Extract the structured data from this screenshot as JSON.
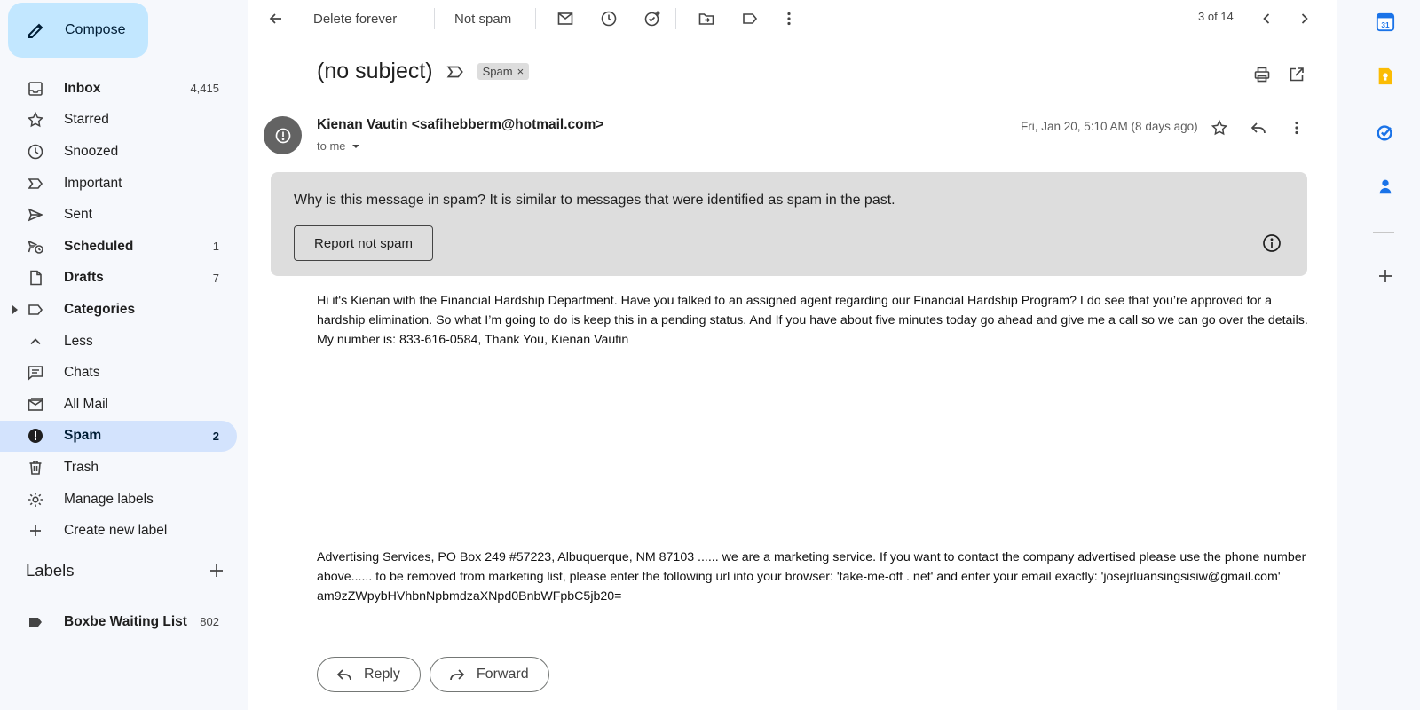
{
  "sidebar": {
    "compose_label": "Compose",
    "items": [
      {
        "label": "Inbox",
        "count": "4,415"
      },
      {
        "label": "Starred",
        "count": ""
      },
      {
        "label": "Snoozed",
        "count": ""
      },
      {
        "label": "Important",
        "count": ""
      },
      {
        "label": "Sent",
        "count": ""
      },
      {
        "label": "Scheduled",
        "count": "1"
      },
      {
        "label": "Drafts",
        "count": "7"
      },
      {
        "label": "Categories",
        "count": ""
      },
      {
        "label": "Less",
        "count": ""
      },
      {
        "label": "Chats",
        "count": ""
      },
      {
        "label": "All Mail",
        "count": ""
      },
      {
        "label": "Spam",
        "count": "2"
      },
      {
        "label": "Trash",
        "count": ""
      },
      {
        "label": "Manage labels",
        "count": ""
      },
      {
        "label": "Create new label",
        "count": ""
      }
    ],
    "labels_heading": "Labels",
    "custom_labels": [
      {
        "label": "Boxbe Waiting List",
        "count": "802"
      }
    ]
  },
  "toolbar": {
    "delete_forever": "Delete forever",
    "not_spam": "Not spam",
    "pager": "3 of 14"
  },
  "email": {
    "subject": "(no subject)",
    "chip": "Spam",
    "chip_close": "×",
    "sender": "Kienan Vautin <safihebberm@hotmail.com>",
    "to": "to me",
    "date": "Fri, Jan 20, 5:10 AM (8 days ago)",
    "spam_why_bold": "Why is this message in spam?",
    "spam_why_rest": " It is similar to messages that were identified as spam in the past.",
    "report_not_spam": "Report not spam",
    "body1": "Hi it's Kienan with the Financial Hardship Department. Have you talked to an assigned agent regarding our Financial Hardship Program? I do see that you’re approved for a hardship elimination. So what I’m going to do is keep this in a pending status. And If you have about five minutes today go ahead and give me a call so we can go over the details. My number is: 833-616-0584, Thank You, Kienan Vautin",
    "body2": "Advertising Services, PO Box 249 #57223, Albuquerque, NM 87103 ...... we are a marketing service. If you want to contact the company advertised please use the phone number above...... to be removed from marketing list, please enter the following url into your browser: 'take-me-off . net' and enter your email exactly: 'josejrluansingsisiw@gmail.com' am9zZWpybHVhbnNpbmdzaXNpd0BnbWFpbC5jb20=",
    "reply_label": "Reply",
    "forward_label": "Forward"
  },
  "rightbar": {
    "calendar_day": "31"
  },
  "colors": {
    "compose_bg": "#c2e7ff",
    "active_nav_bg": "#d3e3fd",
    "spam_box_bg": "#dddddd",
    "calendar": "#1a73e8",
    "keep": "#fbbc04",
    "tasks": "#1a73e8",
    "contacts": "#1a73e8"
  }
}
